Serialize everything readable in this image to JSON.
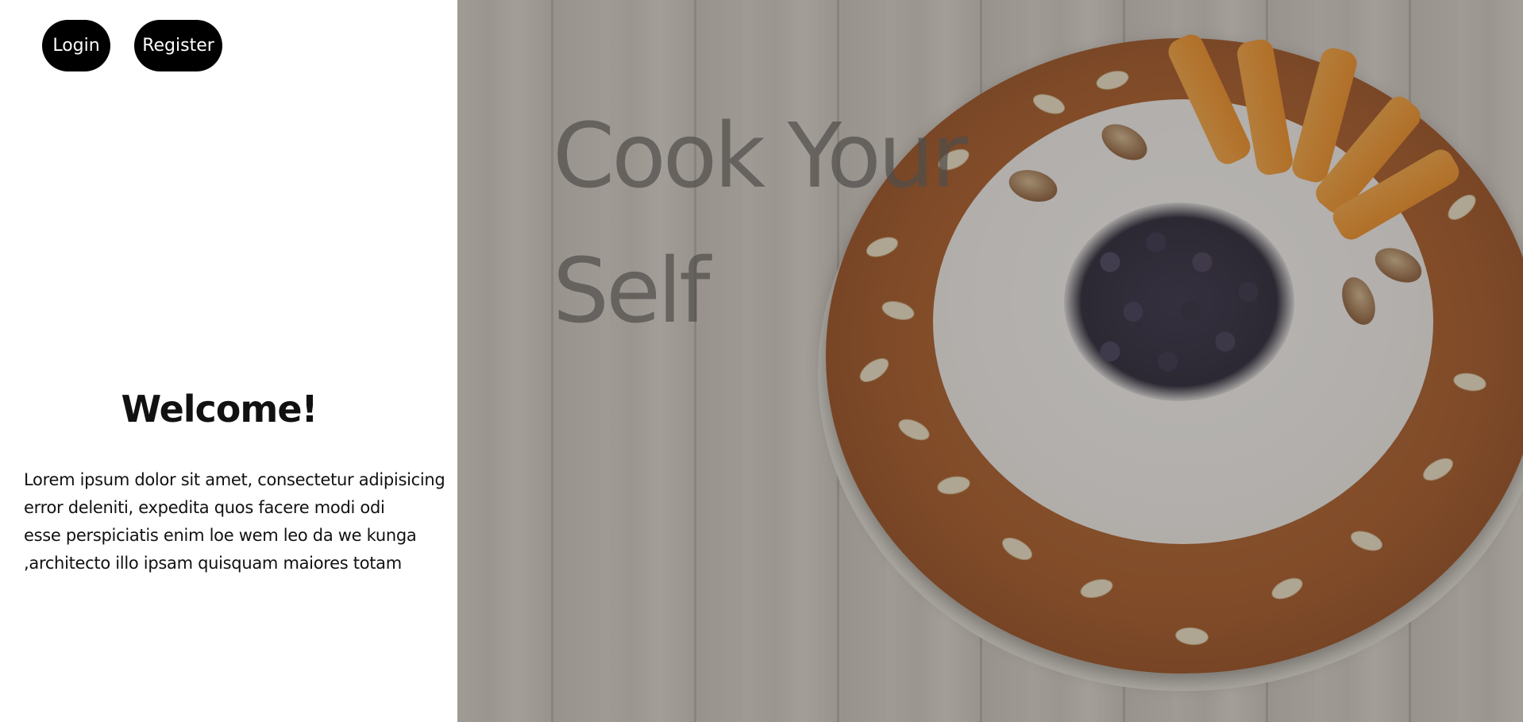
{
  "nav": {
    "login_label": "Login",
    "register_label": "Register"
  },
  "welcome": {
    "title": "Welcome!",
    "lines": [
      "Lorem ipsum dolor sit amet, consectetur adipisicing",
      "error deleniti, expedita quos facere modi odi",
      "esse perspiciatis enim loe wem leo da we kunga",
      ",architecto illo ipsam quisquam maiores totam"
    ]
  },
  "hero": {
    "title_lines": [
      "Cook Your",
      "Self"
    ]
  },
  "colors": {
    "button_bg": "#000000",
    "button_text": "#ffffff",
    "page_bg": "#ffffff"
  }
}
